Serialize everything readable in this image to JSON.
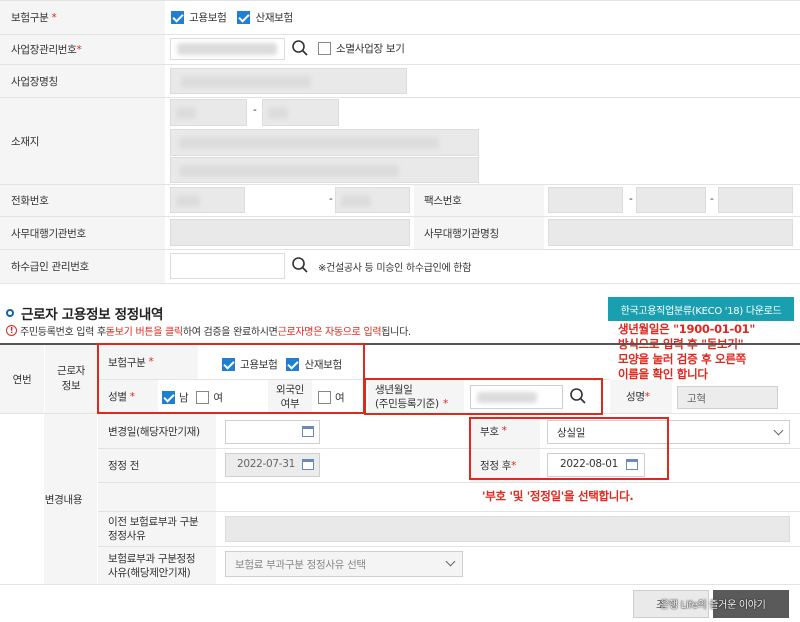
{
  "top_form": {
    "insurance_type_label": "보험구분",
    "employment_insurance": "고용보험",
    "industrial_insurance": "산재보험",
    "workplace_mgmt_no_label": "사업장관리번호",
    "closed_workplace_label": "소멸사업장 보기",
    "workplace_name_label": "사업장명칭",
    "address_label": "소재지",
    "address_dash": "-",
    "phone_label": "전화번호",
    "phone_dash1": "-",
    "phone_dash2": "-",
    "fax_label": "팩스번호",
    "fax_dash1": "-",
    "fax_dash2": "-",
    "agency_no_label": "사무대행기관번호",
    "agency_name_label": "사무대행기관명칭",
    "subcontractor_label": "하수급인 관리번호",
    "subcontractor_note": "※건설공사 등 미승인 하수급인에 한함"
  },
  "section": {
    "bullet": "o",
    "title": "근로자 고용정보 정정내역",
    "keco_button": "한국고용직업분류(KECO '18) 다운로드",
    "notice_prefix": "주민등록번호 입력 후 ",
    "notice_red1": "돋보기 버튼을 클릭",
    "notice_mid": "하여 검증을 완료하시면 ",
    "notice_red2": "근로자명은 자동으로 입력",
    "notice_suffix": "됩니다."
  },
  "annotation_top": {
    "line1": "생년월일은 \"1900-01-01\"",
    "line2": "방식으로 입력 후 \"돋보기\"",
    "line3": "모양을 눌러 검증 후 오른쪽",
    "line4": "이름을 확인 합니다"
  },
  "annotation_mid": "'부호 '및 '정정일'을 선택합니다.",
  "worker": {
    "seq_label": "연번",
    "worker_info_label": "근로자\n정보",
    "insurance_type_label": "보험구분",
    "employment_insurance": "고용보험",
    "industrial_insurance": "산재보험",
    "gender_label": "성별",
    "male": "남",
    "female": "여",
    "foreigner_label": "외국인\n여부",
    "foreigner_yes": "여",
    "birth_label": "생년월일\n(주민등록기준)",
    "name_label": "성명",
    "name_value": "고혁"
  },
  "change": {
    "section_label": "변경내용",
    "change_date_label": "변경일(해당자만기재)",
    "code_label": "부호",
    "code_value": "상실일",
    "before_label": "정정 전",
    "before_value": "2022-07-31",
    "after_label": "정정 후",
    "after_value": "2022-08-01",
    "prev_reason_label": "이전 보험료부과 구분\n정정사유",
    "reason_label": "보험료부과 구분정정\n사유(해당제안기재)",
    "reason_placeholder": "보험료 부과구분 정정사유 선택"
  },
  "footer": {
    "watermark": "은행 Life의 즐거운 이야기",
    "button_partial": "조"
  }
}
